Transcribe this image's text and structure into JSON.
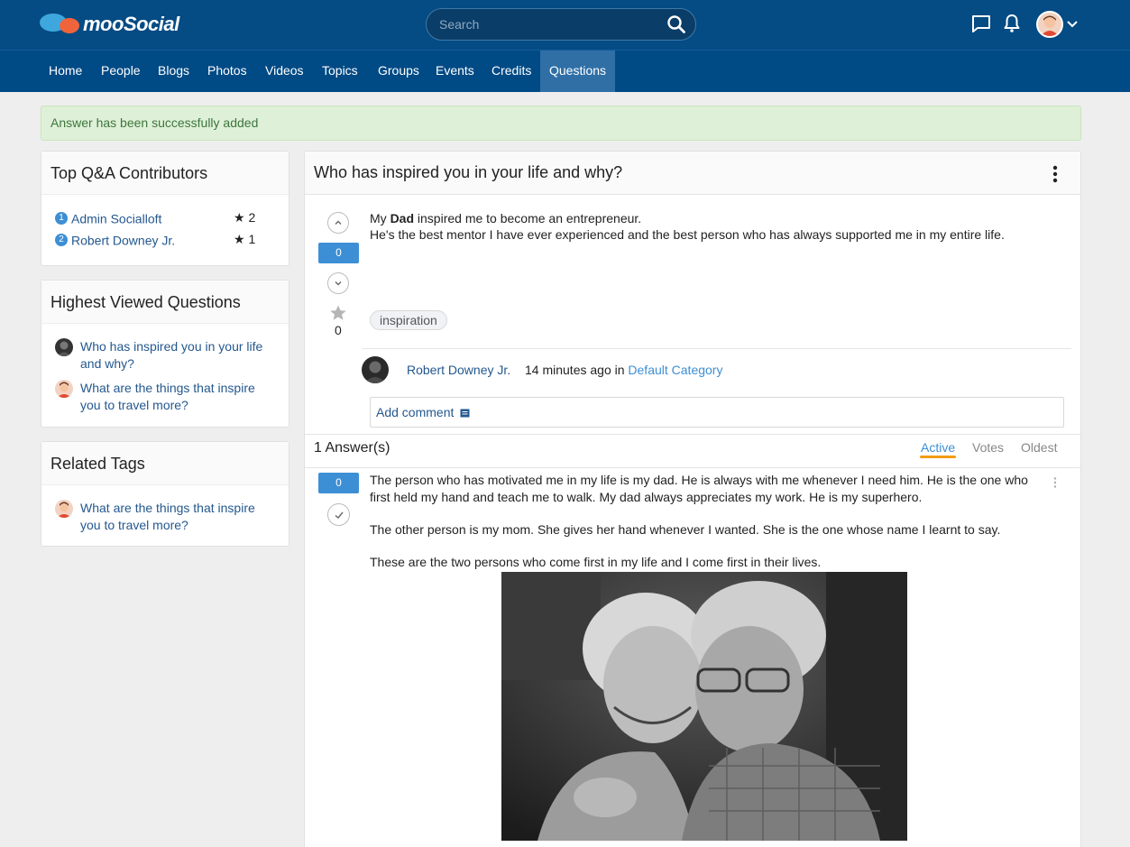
{
  "header": {
    "logo_text": "mooSocial",
    "search_placeholder": "Search",
    "icons": [
      "chat-icon",
      "bell-icon",
      "search-icon",
      "chevron-down-icon"
    ]
  },
  "nav": {
    "items": [
      "Home",
      "People",
      "Blogs",
      "Photos",
      "Videos",
      "Topics",
      "Groups",
      "Events",
      "Credits",
      "Questions"
    ],
    "active": "Questions"
  },
  "alert": {
    "text": "Answer has been successfully added"
  },
  "sidebar": {
    "contributors": {
      "title": "Top Q&A Contributors",
      "items": [
        {
          "rank": "1",
          "name": "Admin Socialloft",
          "score": "★ 2"
        },
        {
          "rank": "2",
          "name": "Robert Downey Jr.",
          "score": "★ 1"
        }
      ]
    },
    "highest_viewed": {
      "title": "Highest Viewed Questions",
      "items": [
        {
          "text": "Who has inspired you in your life and why?"
        },
        {
          "text": "What are the things that inspire you to travel more?"
        }
      ]
    },
    "related_tags": {
      "title": "Related Tags",
      "items": [
        {
          "text": "What are the things that inspire you to travel more?"
        }
      ]
    }
  },
  "question": {
    "title": "Who has inspired you in your life and why?",
    "vote_count": "0",
    "fav_count": "0",
    "body_line1_pre": "My ",
    "body_line1_bold": "Dad",
    "body_line1_post": " inspired me to become an entrepreneur.",
    "body_line2": "He's the best mentor I have ever experienced and the best person who has always supported me in my entire life.",
    "tag": "inspiration",
    "author": "Robert Downey Jr.",
    "time_ago": "14 minutes ago in ",
    "category": "Default Category",
    "add_comment": "Add comment"
  },
  "answers": {
    "header": "1 Answer(s)",
    "sort": [
      "Active",
      "Votes",
      "Oldest"
    ],
    "active_sort": "Active",
    "items": [
      {
        "vote_count": "0",
        "paragraphs": [
          "The person who has motivated me in my life is my dad. He is always with me whenever I need him. He is the one who first held my hand and teach me to walk. My dad always appreciates my work. He is my superhero.",
          "The other person is my mom. She gives her hand whenever I wanted. She is the one whose name I learnt to say.",
          "These are the two persons who come first in my life and I come first in their lives."
        ]
      }
    ]
  },
  "colors": {
    "header_bg": "#054b84",
    "nav_bg": "#004a85",
    "nav_active": "#2f6fa6",
    "link": "#24588f",
    "accent": "#3d8fd5",
    "sort_underline": "#f39c12",
    "alert_bg": "#dff0d8"
  }
}
